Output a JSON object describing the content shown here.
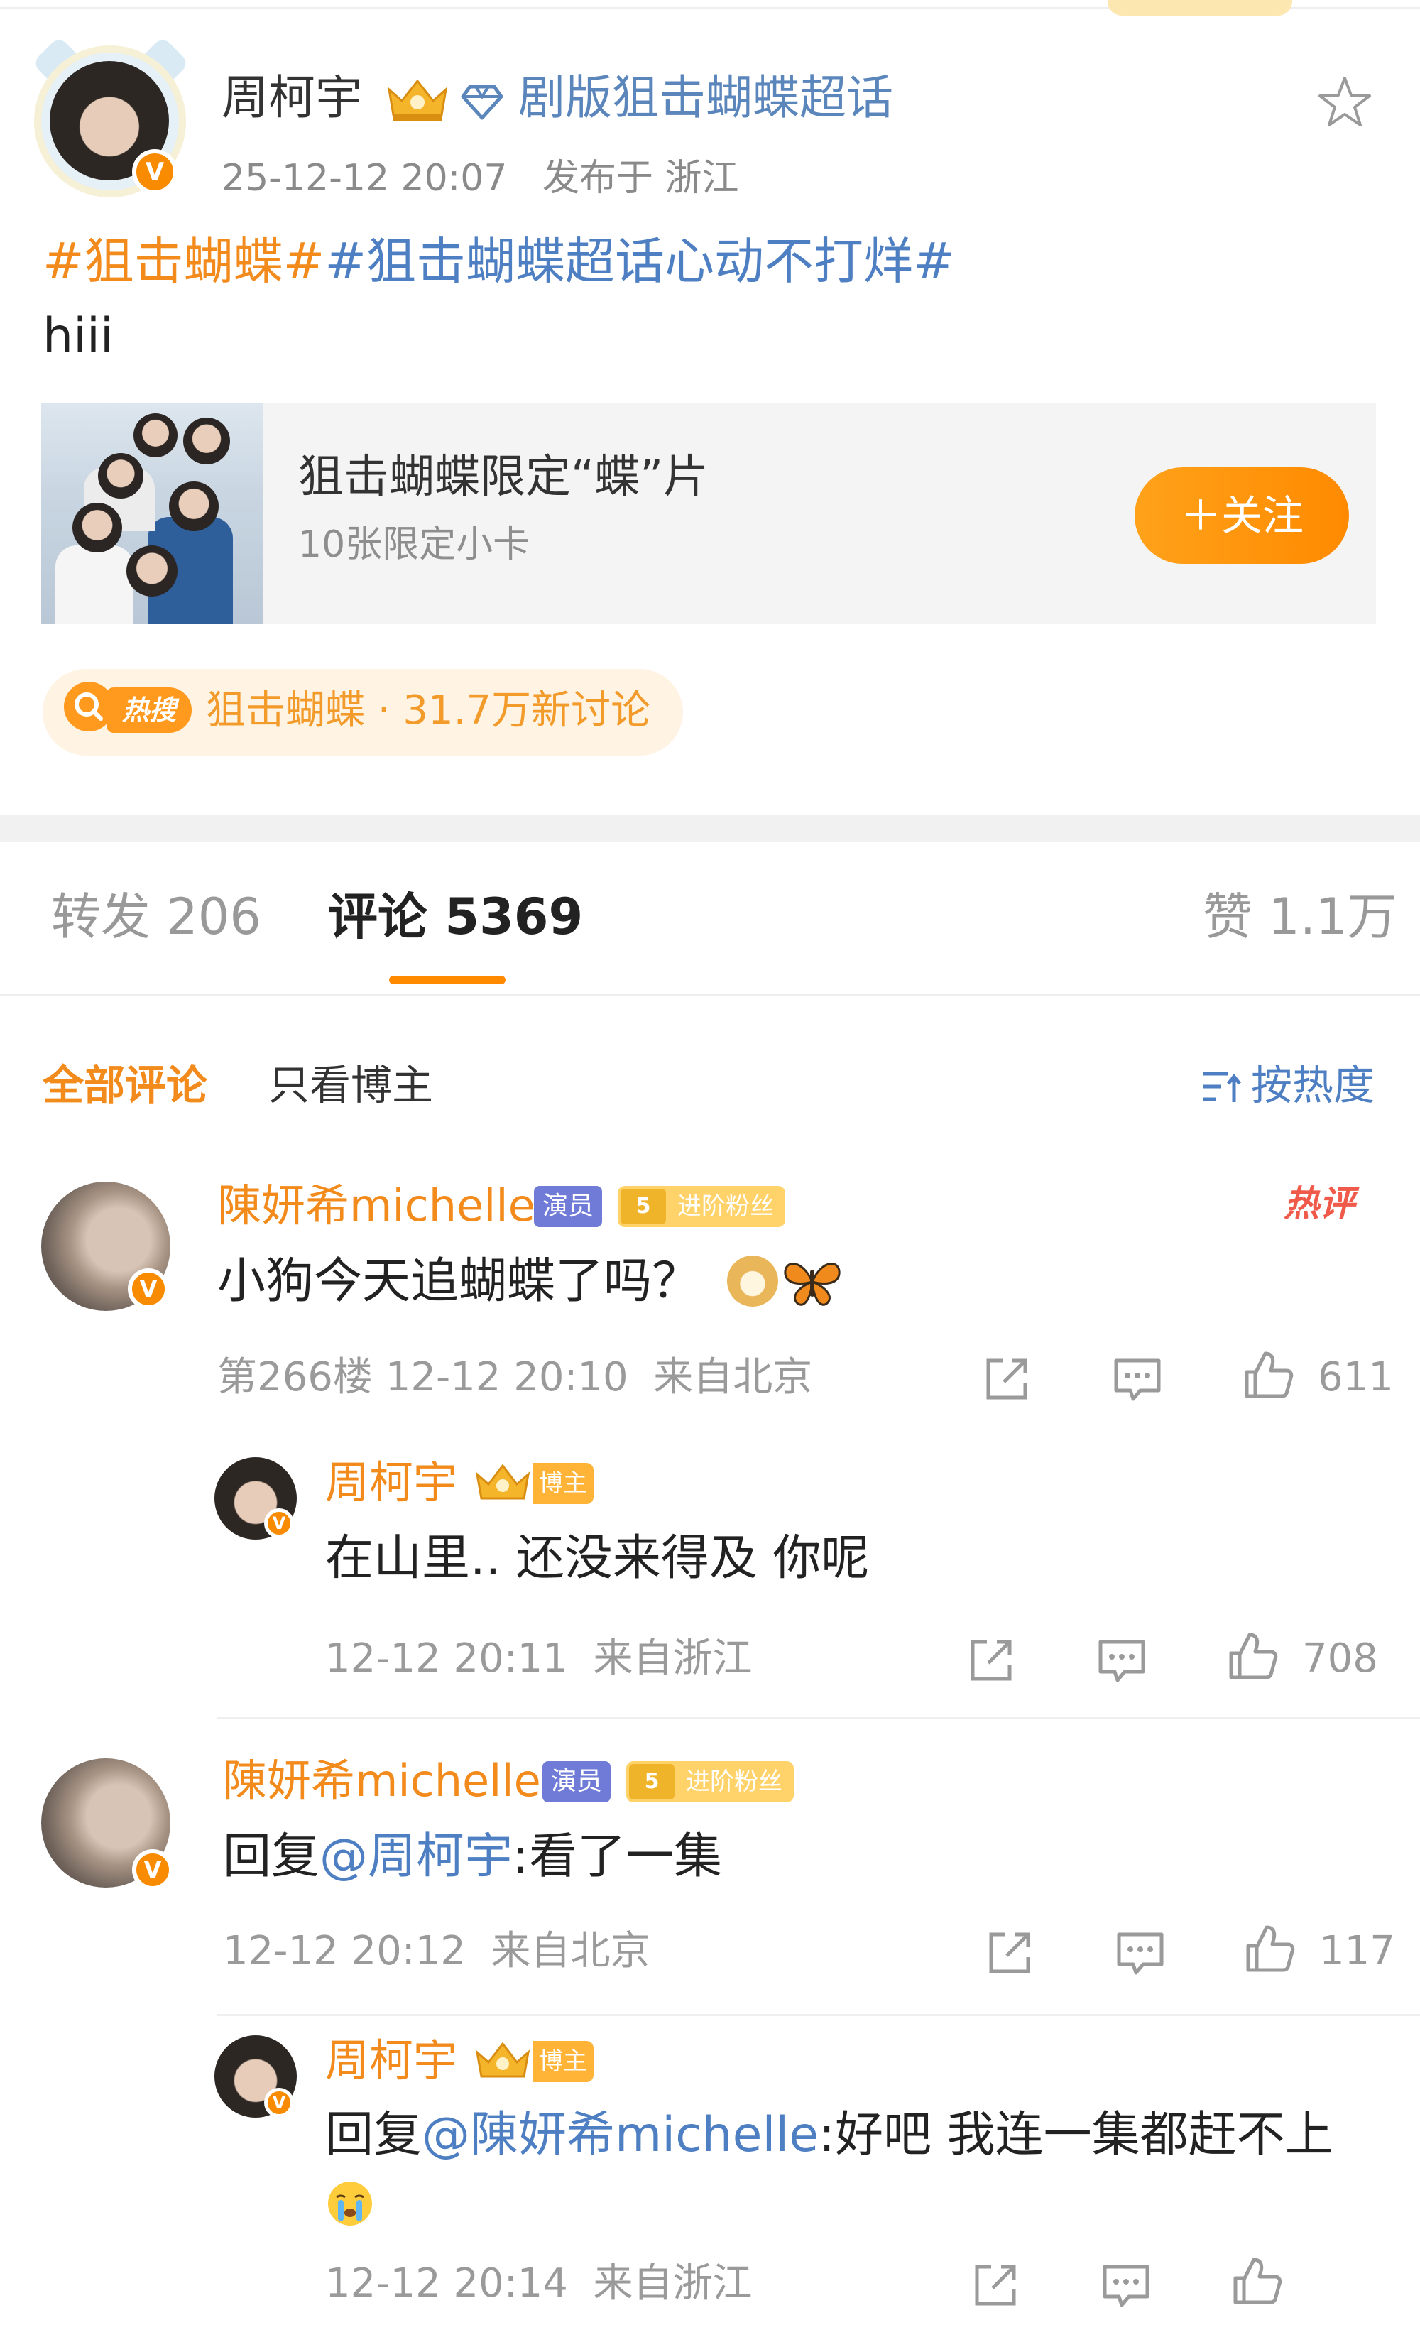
{
  "post": {
    "author": "周柯宇",
    "supertopic": "剧版狙击蝴蝶超话",
    "time": "25-12-12 20:07",
    "location": "发布于 浙江",
    "hashtag_1": "#狙击蝴蝶#",
    "hashtag_2": "#狙击蝴蝶超话心动不打烊#",
    "text": "hiii",
    "avatar_badge": "V"
  },
  "promo_card": {
    "title": "狙击蝴蝶限定“蝶”片",
    "subtitle": "10张限定小卡",
    "follow_label": "＋关注"
  },
  "hot_search": {
    "badge": "热搜",
    "text": "狙击蝴蝶 · 31.7万新讨论"
  },
  "tabs": {
    "repost": "转发 206",
    "comments": "评论 5369",
    "likes": "赞 1.1万"
  },
  "filters": {
    "all": "全部评论",
    "author_only": "只看博主",
    "sort": "按热度"
  },
  "comments": [
    {
      "name": "陳妍希michelle",
      "role_badge": "演员",
      "fan_level": "5",
      "fan_badge": "进阶粉丝",
      "hot_tag": "热评",
      "text": "小狗今天追蝴蝶了吗？",
      "floor": "第266楼",
      "time": "12-12 20:10",
      "location": "来自北京",
      "likes": "611",
      "reply": {
        "name": "周柯宇",
        "host_badge": "博主",
        "text": "在山里.. 还没来得及 你呢",
        "time": "12-12 20:11",
        "location": "来自浙江",
        "likes": "708"
      }
    },
    {
      "name": "陳妍希michelle",
      "role_badge": "演员",
      "fan_level": "5",
      "fan_badge": "进阶粉丝",
      "reply_prefix": "回复",
      "mention": "@周柯宇",
      "text": ":看了一集",
      "time": "12-12 20:12",
      "location": "来自北京",
      "likes": "117",
      "reply": {
        "name": "周柯宇",
        "host_badge": "博主",
        "reply_prefix": "回复",
        "mention": "@陳妍希michelle",
        "text": ":好吧 我连一集都赶不上",
        "time": "12-12 20:14",
        "location": "来自浙江"
      }
    }
  ],
  "colors": {
    "accent_orange": "#ff8a00",
    "link_blue": "#4e7fc2",
    "hashtag_orange": "#f28a1c",
    "hot_red": "#f05a4a"
  },
  "icons": [
    "crown-icon",
    "diamond-icon",
    "star-icon",
    "share-icon",
    "comment-icon",
    "like-icon",
    "sort-icon",
    "dog-emoji-icon",
    "butterfly-emoji-icon",
    "crying-emoji-icon"
  ]
}
